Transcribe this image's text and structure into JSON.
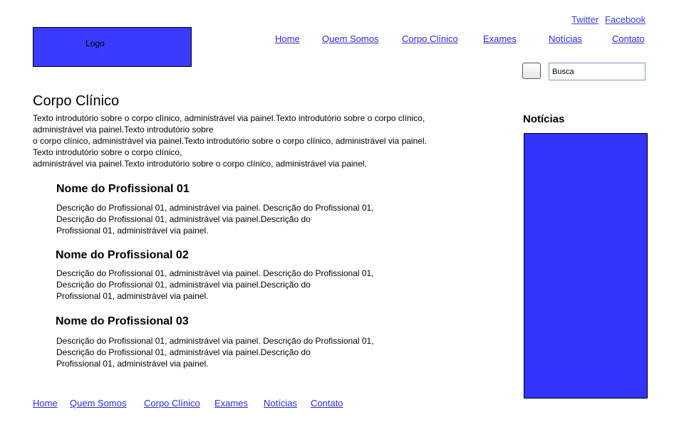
{
  "header": {
    "logo_text": "Logo",
    "social": {
      "twitter": "Twitter",
      "facebook": "Facebook"
    },
    "nav": [
      "Home",
      "Quem Somos",
      "Corpo Clínico",
      "Exames",
      "Notícias",
      "Contato"
    ]
  },
  "search": {
    "placeholder": "Busca"
  },
  "main": {
    "title": "Corpo Clínico",
    "intro_lines": [
      "Texto introdutório sobre o corpo clínico, administrável via painel.Texto introdutório sobre o corpo clínico,",
      "administrável via painel.Texto introdutório sobre",
      "o corpo clínico, administrável via painel.Texto introdutório sobre o corpo clínico, administrável via painel.",
      "Texto introdutório sobre o corpo clínico,",
      "administrável via painel.Texto introdutório sobre o corpo clínico, administrável via painel."
    ],
    "professionals": [
      {
        "name": "Nome do Profissional 01",
        "desc_lines": [
          "Descrição do Profissional 01, administrável via painel. Descrição do Profissional 01,",
          "Descrição do Profissional 01, administrável via painel.Descrição do",
          "Profissional 01, administrável via painel."
        ]
      },
      {
        "name": "Nome do Profissional 02",
        "desc_lines": [
          "Descrição do Profissional 01, administrável via painel. Descrição do Profissional 01,",
          "Descrição do Profissional 01, administrável via painel.Descrição do",
          "Profissional 01, administrável via painel."
        ]
      },
      {
        "name": "Nome do Profissional 03",
        "desc_lines": [
          "Descrição do Profissional 01, administrável via painel. Descrição do Profissional 01,",
          "Descrição do Profissional 01, administrável via painel.Descrição do",
          "Profissional 01, administrável via painel."
        ]
      }
    ]
  },
  "sidebar": {
    "news_title": "Notícias"
  },
  "footer": {
    "nav": [
      "Home",
      "Quem Somos",
      "Corpo Clínico",
      "Exames",
      "Notícias",
      "Contato"
    ]
  },
  "colors": {
    "placeholder_blue": "#3b3bff",
    "link": "#2b2bd0"
  }
}
